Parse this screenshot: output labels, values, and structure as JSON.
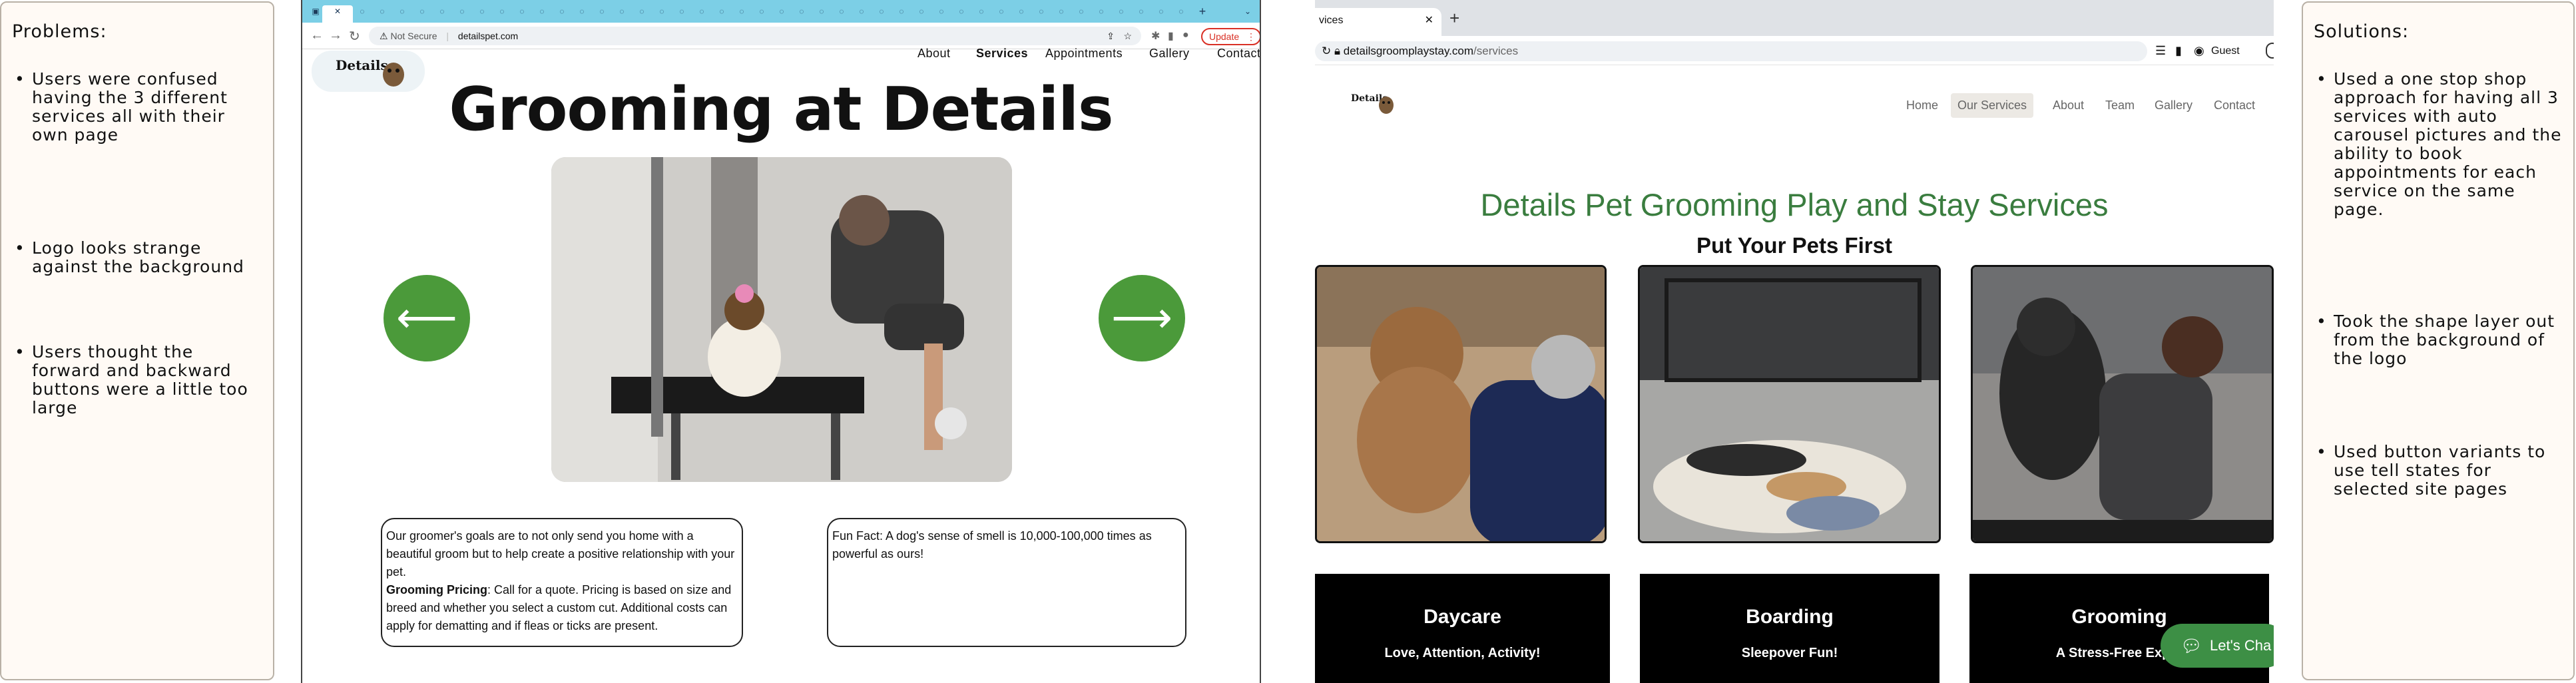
{
  "problems": {
    "title": "Problems:",
    "items": [
      "Users were confused having the 3 different services all with their own page",
      "Logo looks strange against the background",
      "Users thought the forward and backward buttons were a little too large"
    ]
  },
  "solutions": {
    "title": "Solutions:",
    "items": [
      "Used a one stop shop approach for having all 3 services with auto carousel pictures and the ability to book appointments for each service on the same page.",
      "Took the shape layer out from the background of the logo",
      "Used button variants to use tell states for selected site pages"
    ]
  },
  "old_site": {
    "security": "Not Secure",
    "url": "detailspet.com",
    "update_label": "Update",
    "logo_text": "Details",
    "nav": [
      "About",
      "Services",
      "Appointments",
      "Gallery",
      "Contact"
    ],
    "active_nav": "Services",
    "hero_title": "Grooming at Details",
    "prev_glyph": "⟵",
    "next_glyph": "⟶",
    "groom_text_1": "Our groomer's goals are to not only send you home with a beautiful groom but to help create a positive relationship with your pet.",
    "pricing_label": "Grooming Pricing",
    "pricing_text": ":  Call for a quote.  Pricing is based on size and breed and whether you select a custom cut.  Additional costs can apply for dematting and if fleas or ticks are present.",
    "fun_fact": "Fun Fact:  A dog's sense of smell is 10,000-100,000 times as powerful as ours!"
  },
  "new_site": {
    "tab_title": "vices",
    "url_host": "detailsgroomplaystay.com",
    "url_path": "/services",
    "guest_label": "Guest",
    "nav": [
      "Home",
      "Our Services",
      "About",
      "Team",
      "Gallery",
      "Contact"
    ],
    "active_nav": "Our Services",
    "headline": "Details Pet Grooming Play and Stay Services",
    "subhead": "Put Your Pets First",
    "cards": [
      {
        "name": "Daycare",
        "tag": "Love, Attention, Activity!"
      },
      {
        "name": "Boarding",
        "tag": "Sleepover Fun!"
      },
      {
        "name": "Grooming",
        "tag": "A Stress-Free Exper"
      }
    ],
    "chat_label": "Let's Cha"
  },
  "colors": {
    "accent_green": "#4b9a3a",
    "headline_green": "#3a7d3f",
    "tab_strip_blue": "#7ccfe6",
    "update_red": "#d93025"
  }
}
